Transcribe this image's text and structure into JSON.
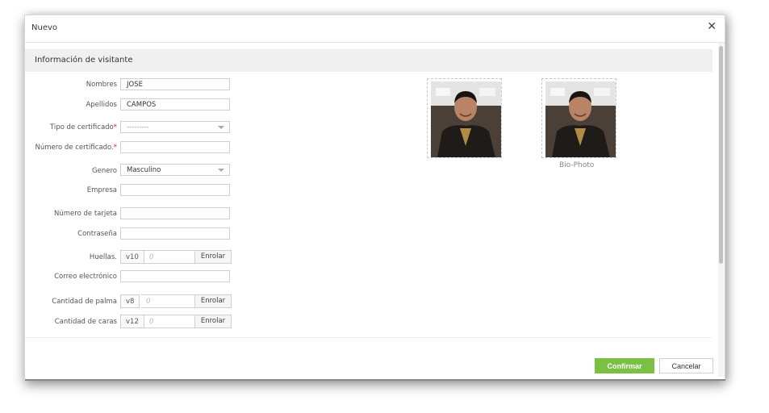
{
  "dialog": {
    "title": "Nuevo",
    "close_icon": "close-icon"
  },
  "section": {
    "title": "Información de visitante"
  },
  "form": {
    "nombres": {
      "label": "Nombres",
      "value": "JOSE"
    },
    "apellidos": {
      "label": "Apellidos",
      "value": "CAMPOS"
    },
    "tipo_certificado": {
      "label": "Tipo de certificado",
      "required": "*",
      "value": "---------"
    },
    "numero_certificado": {
      "label": "Número de certificado.",
      "required": "*",
      "value": ""
    },
    "genero": {
      "label": "Genero",
      "value": "Masculino"
    },
    "empresa": {
      "label": "Empresa",
      "value": ""
    },
    "numero_tarjeta": {
      "label": "Número de tarjeta",
      "value": ""
    },
    "contrasena": {
      "label": "Contraseña",
      "value": ""
    },
    "huellas": {
      "label": "Huellas.",
      "version": "v10",
      "count": "0",
      "button": "Enrolar"
    },
    "correo": {
      "label": "Correo electrónico",
      "value": ""
    },
    "palma": {
      "label": "Cantidad de palma",
      "version": "v8",
      "count": "0",
      "button": "Enrolar"
    },
    "caras": {
      "label": "Cantidad de caras",
      "version": "v12",
      "count": "0",
      "button": "Enrolar"
    }
  },
  "photos": {
    "bio_photo_label": "Bio-Photo"
  },
  "footer": {
    "confirm_label": "Confirmar",
    "cancel_label": "Cancelar"
  },
  "colors": {
    "confirm": "#7ac143",
    "required": "#e02020",
    "section_bg": "#f0f0f0"
  }
}
